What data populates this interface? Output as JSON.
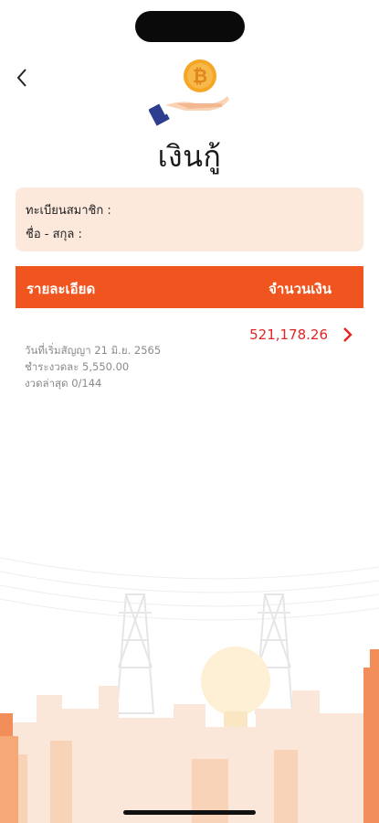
{
  "page": {
    "title": "เงินกู้"
  },
  "member_info": {
    "member_id_label": "ทะเบียนสมาชิก :",
    "name_label": "ชื่อ - สกุล :"
  },
  "table": {
    "col_detail": "รายละเอียด",
    "col_amount": "จำนวนเงิน"
  },
  "loans": [
    {
      "amount": "521,178.26",
      "start_date": "วันที่เริ่มสัญญา   21 มิ.ย. 2565",
      "installment": "ชำระงวดละ 5,550.00",
      "latest_period": "งวดล่าสุด   0/144"
    }
  ],
  "icons": {
    "back": "chevron-left-icon",
    "header": "hand-coin-icon",
    "row_arrow": "chevron-right-icon"
  },
  "colors": {
    "accent": "#f0541f",
    "card_bg": "#fce9dc",
    "amount": "#e52424"
  }
}
